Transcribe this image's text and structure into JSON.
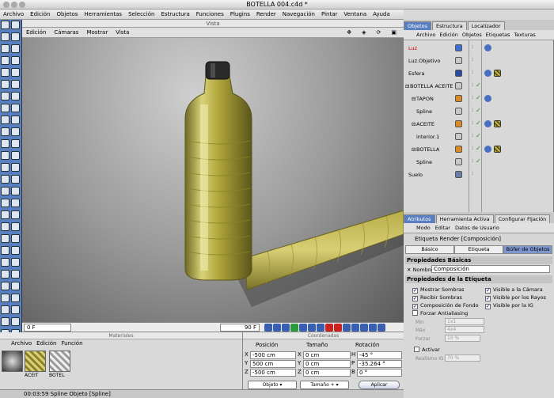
{
  "window": {
    "title": "BOTELLA 004.c4d *"
  },
  "main_menu": [
    "Archivo",
    "Edición",
    "Objetos",
    "Herramientas",
    "Selección",
    "Estructura",
    "Funciones",
    "Plugins",
    "Render",
    "Navegación",
    "Pintar",
    "Ventana",
    "Ayuda"
  ],
  "viewport": {
    "header": "Vista",
    "menu": [
      "Edición",
      "Cámaras",
      "Mostrar",
      "Vista"
    ]
  },
  "timeline": {
    "frame_start": "0 F",
    "frame_end": "90 F"
  },
  "materials": {
    "header": "Materiales",
    "menu": [
      "Archivo",
      "Edición",
      "Función"
    ],
    "items": [
      "ACEIT",
      "BOTEL"
    ]
  },
  "coordinates": {
    "header": "Coordenadas",
    "col_position": "Posición",
    "col_size": "Tamaño",
    "col_rotation": "Rotación",
    "rows": [
      {
        "axis": "X",
        "pos": "-500 cm",
        "size_axis": "X",
        "size": "0 cm",
        "rot_axis": "H",
        "rot": "-45 °"
      },
      {
        "axis": "Y",
        "pos": "500 cm",
        "size_axis": "Y",
        "size": "0 cm",
        "rot_axis": "P",
        "rot": "-35.264 °"
      },
      {
        "axis": "Z",
        "pos": "-500 cm",
        "size_axis": "Z",
        "size": "0 cm",
        "rot_axis": "B",
        "rot": "0 °"
      }
    ],
    "mode_select": "Objeto",
    "size_select": "Tamaño +",
    "apply": "Aplicar"
  },
  "status": {
    "text": "00:03:59  Spline Objeto [Spline]"
  },
  "objects": {
    "tabs": [
      "Objetos",
      "Estructura",
      "Localizador"
    ],
    "menu": [
      "Archivo",
      "Edición",
      "Objetos",
      "Etiquetas",
      "Texturas"
    ],
    "items": [
      {
        "name": "Luz",
        "red": true
      },
      {
        "name": "Luz.Objetivo"
      },
      {
        "name": "Esfera"
      },
      {
        "name": "BOTELLA ACEITE"
      },
      {
        "name": "TAPON"
      },
      {
        "name": "Spline"
      },
      {
        "name": "ACEITE"
      },
      {
        "name": "interior.1"
      },
      {
        "name": "BOTELLA"
      },
      {
        "name": "Spline"
      },
      {
        "name": "Suelo"
      }
    ]
  },
  "attributes": {
    "tabs": [
      "Atributos",
      "Herramienta Activa",
      "Configurar Fijación"
    ],
    "menu": [
      "Modo",
      "Editar",
      "Datos de Usuario"
    ],
    "title": "Etiqueta Render [Composición]",
    "subtabs": [
      "Básico",
      "Etiqueta",
      "Búfer de Objetos"
    ],
    "basic_header": "Propiedades Básicas",
    "name_label": "Nombre",
    "name_value": "Composición",
    "tag_header": "Propiedades de la Etiqueta",
    "checks_left": [
      {
        "label": "Mostrar Sombras",
        "on": true
      },
      {
        "label": "Recibir Sombras",
        "on": true
      },
      {
        "label": "Composición de Fondo",
        "on": true
      },
      {
        "label": "Forzar Antialiasing",
        "on": false
      }
    ],
    "checks_right": [
      {
        "label": "Visible a la Cámara",
        "on": true
      },
      {
        "label": "Visible por los Rayos",
        "on": true
      },
      {
        "label": "Visible por la IG",
        "on": true
      }
    ],
    "min_label": "Min",
    "min_value": "1x1",
    "max_label": "Máx",
    "max_value": "4x4",
    "force_label": "Forzar",
    "force_value": "10 %",
    "activate_label": "Activar",
    "realism_label": "Realismo IG",
    "realism_value": "70 %"
  }
}
